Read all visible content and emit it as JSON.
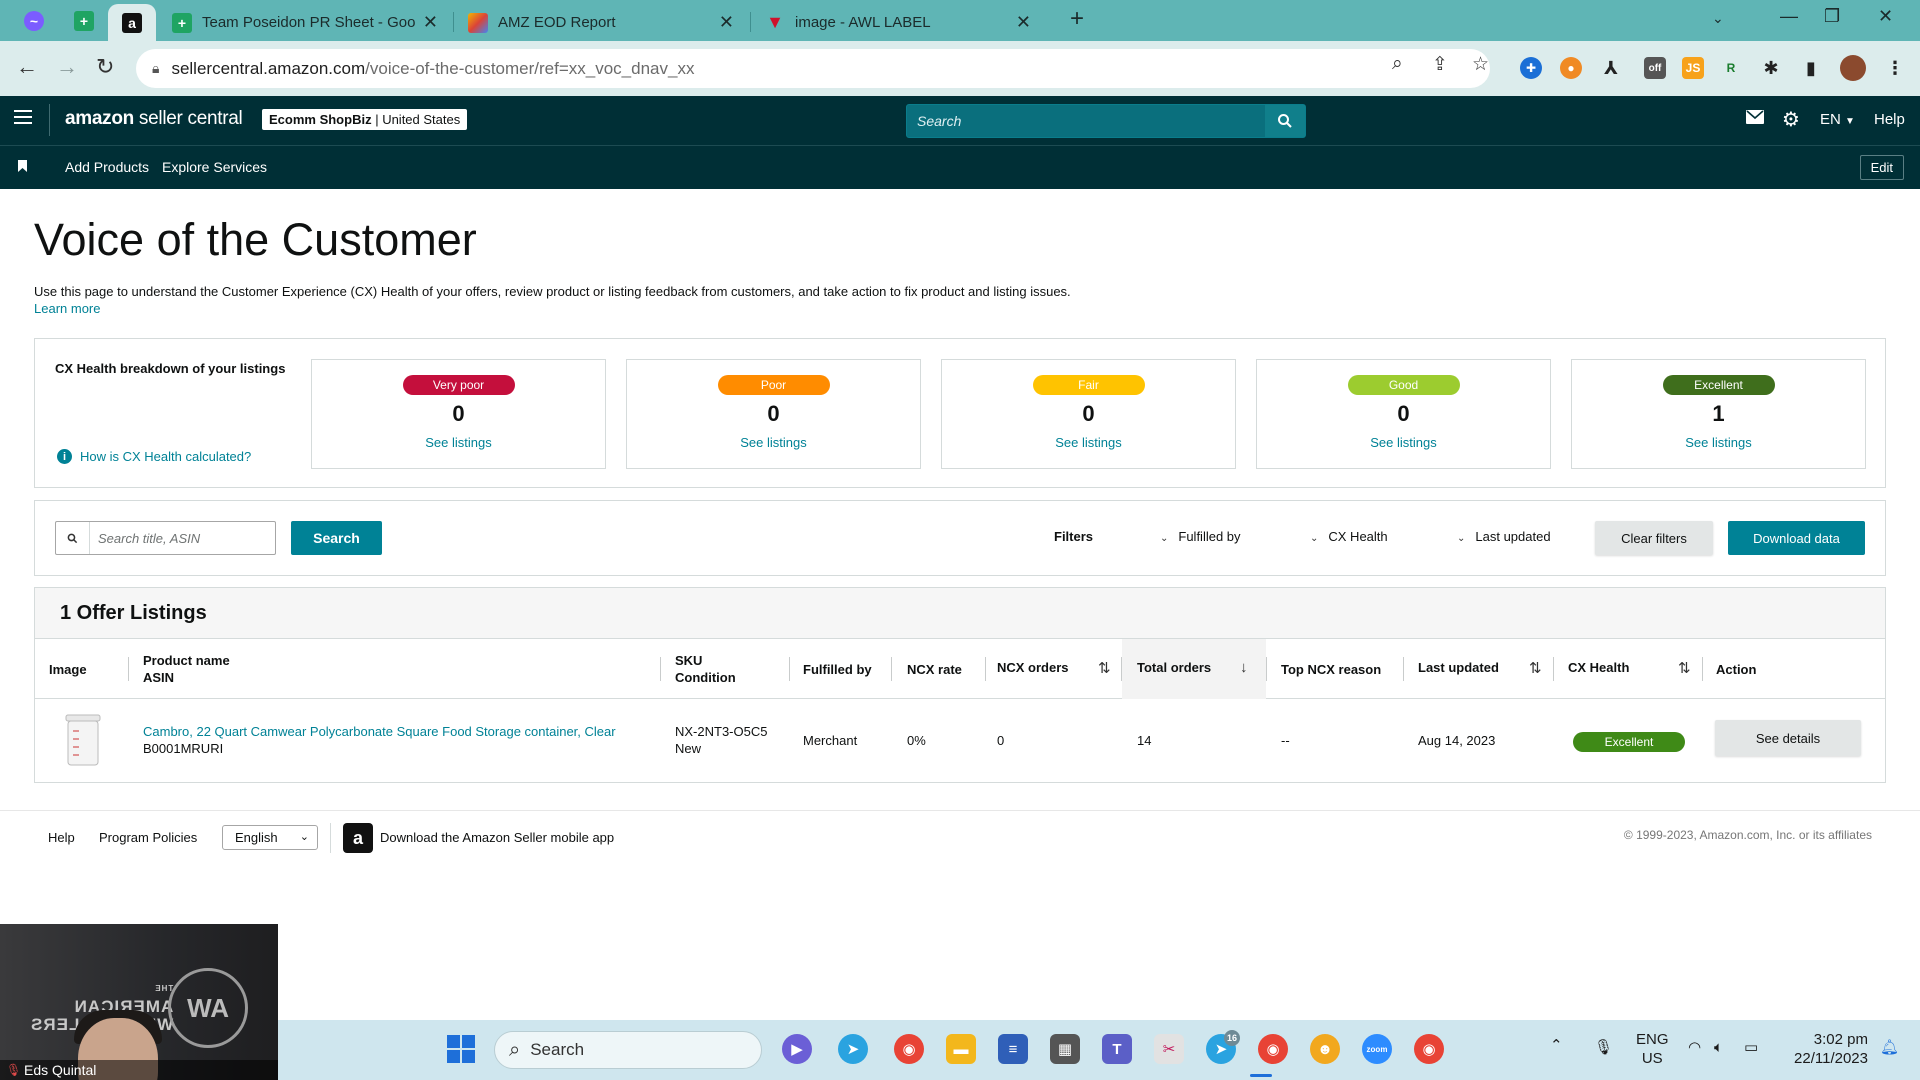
{
  "browser": {
    "tabs": [
      {
        "title": "Team Poseidon PR Sheet - Goog",
        "icon": "sheets-icon"
      },
      {
        "title": "AMZ EOD Report",
        "icon": "colorful-icon"
      },
      {
        "title": "image - AWL LABEL",
        "icon": "awl-icon"
      }
    ],
    "active_tab_favicon": "a",
    "url_host": "sellercentral.amazon.com",
    "url_path": "/voice-of-the-customer/ref=xx_voc_dnav_xx",
    "ext_badge": "off",
    "ext_js": "JS"
  },
  "header": {
    "logo_amazon": "amazon",
    "logo_rest": " seller central",
    "store_name": "Ecomm ShopBiz",
    "store_region": "United States",
    "search_placeholder": "Search",
    "lang": "EN",
    "help": "Help"
  },
  "subnav": {
    "items": [
      "Add Products",
      "Explore Services"
    ],
    "edit": "Edit"
  },
  "page": {
    "title": "Voice of the Customer",
    "description": "Use this page to understand the Customer Experience (CX) Health of your offers, review product or listing feedback from customers, and take action to fix product and listing issues.",
    "learn_more": "Learn more"
  },
  "cx_breakdown": {
    "heading": "CX Health breakdown of your listings",
    "help_link": "How is CX Health calculated?",
    "cards": [
      {
        "label": "Very poor",
        "count": "0",
        "link": "See listings",
        "color": "#c40f3c"
      },
      {
        "label": "Poor",
        "count": "0",
        "link": "See listings",
        "color": "#ff8c00"
      },
      {
        "label": "Fair",
        "count": "0",
        "link": "See listings",
        "color": "#ffc300"
      },
      {
        "label": "Good",
        "count": "0",
        "link": "See listings",
        "color": "#9ccc2f"
      },
      {
        "label": "Excellent",
        "count": "1",
        "link": "See listings",
        "color": "#3f6e1c"
      }
    ]
  },
  "filters": {
    "search_placeholder": "Search title, ASIN",
    "search_button": "Search",
    "filters_label": "Filters",
    "dropdowns": [
      "Fulfilled by",
      "CX Health",
      "Last updated"
    ],
    "clear": "Clear filters",
    "download": "Download data"
  },
  "listings": {
    "title": "1 Offer Listings",
    "columns": {
      "image": "Image",
      "product": "Product name",
      "asin": "ASIN",
      "sku": "SKU",
      "condition": "Condition",
      "fulfilled": "Fulfilled by",
      "ncx_rate": "NCX rate",
      "ncx_orders": "NCX orders",
      "total_orders": "Total orders",
      "top_ncx": "Top NCX reason",
      "last_updated": "Last updated",
      "cx_health": "CX Health",
      "action": "Action"
    },
    "rows": [
      {
        "product_name": "Cambro, 22 Quart Camwear Polycarbonate Square Food Storage container, Clear",
        "asin": "B0001MRURI",
        "sku": "NX-2NT3-O5C5",
        "condition": "New",
        "fulfilled_by": "Merchant",
        "ncx_rate": "0%",
        "ncx_orders": "0",
        "total_orders": "14",
        "top_ncx_reason": "--",
        "last_updated": "Aug 14, 2023",
        "cx_health": "Excellent",
        "action": "See details"
      }
    ]
  },
  "footer": {
    "help": "Help",
    "policies": "Program Policies",
    "language": "English",
    "app_text": "Download the Amazon Seller mobile app",
    "copyright": "© 1999-2023, Amazon.com, Inc. or its affiliates"
  },
  "webcam": {
    "name": "Eds Quintal",
    "logo_line1": "THE",
    "logo_line2": "AMERICAN",
    "logo_line3": "WHOLESALERS"
  },
  "taskbar": {
    "search": "Search",
    "telegram_badge": "16",
    "lang_line1": "ENG",
    "lang_line2": "US",
    "time": "3:02 pm",
    "date": "22/11/2023"
  }
}
